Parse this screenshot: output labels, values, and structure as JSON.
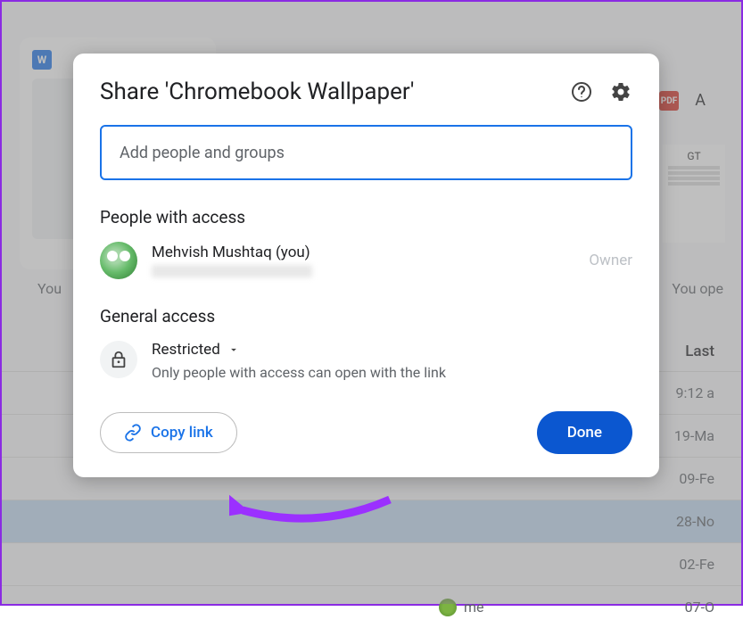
{
  "dialog": {
    "title": "Share 'Chromebook Wallpaper'",
    "input_placeholder": "Add people and groups",
    "section_people": "People with access",
    "person": {
      "name": "Mehvish Mushtaq (you)",
      "role": "Owner"
    },
    "section_general": "General access",
    "access_mode": "Restricted",
    "access_desc": "Only people with access can open with the link",
    "copy_link": "Copy link",
    "done": "Done"
  },
  "background": {
    "you": "You",
    "you_opened": "You ope",
    "a": "A",
    "gt": "GT",
    "last_header": "Last",
    "me": "me",
    "rows": [
      "9:12 a",
      "19-Ma",
      "09-Fe",
      "28-No",
      "02-Fe",
      "07-O"
    ]
  }
}
